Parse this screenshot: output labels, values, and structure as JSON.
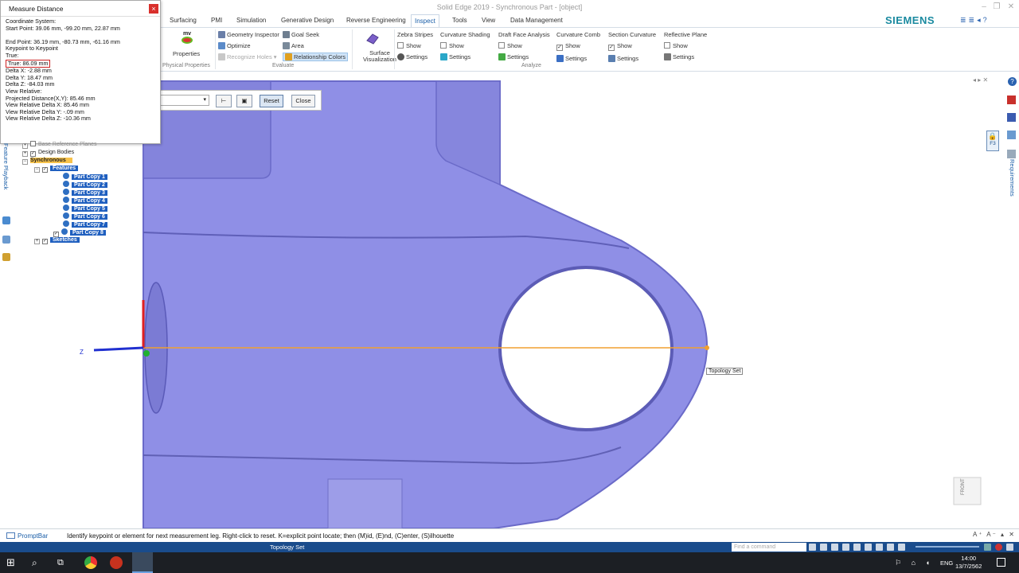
{
  "window": {
    "title": "Solid Edge 2019 - Synchronous Part - [object]",
    "brand": "SIEMENS"
  },
  "ribbon": {
    "tabs": [
      "Surfacing",
      "PMI",
      "Simulation",
      "Generative Design",
      "Reverse Engineering",
      "Inspect",
      "Tools",
      "View",
      "Data Management"
    ],
    "active_tab": "Inspect",
    "physical_properties": {
      "properties_label": "Properties",
      "mv_label": "mv",
      "group_label": "Physical Properties"
    },
    "evaluate": {
      "geometry_inspector": "Geometry Inspector",
      "goal_seek": "Goal Seek",
      "optimize": "Optimize",
      "area": "Area",
      "recognize_holes": "Recognize Holes",
      "relationship_colors": "Relationship Colors",
      "group_label": "Evaluate"
    },
    "surface_visualization": {
      "line1": "Surface",
      "line2": "Visualization"
    },
    "analyze": {
      "group_label": "Analyze",
      "sections": [
        {
          "title": "Zebra Stripes",
          "show": "Show",
          "settings": "Settings",
          "checked": false
        },
        {
          "title": "Curvature Shading",
          "show": "Show",
          "settings": "Settings",
          "checked": false
        },
        {
          "title": "Draft Face Analysis",
          "show": "Show",
          "settings": "Settings",
          "checked": false
        },
        {
          "title": "Curvature Comb",
          "show": "Show",
          "settings": "Settings",
          "checked": true
        },
        {
          "title": "Section Curvature",
          "show": "Show",
          "settings": "Settings",
          "checked": true
        },
        {
          "title": "Reflective Plane",
          "show": "Show",
          "settings": "Settings",
          "checked": false
        }
      ]
    }
  },
  "measure_dialog": {
    "title": "Measure Distance",
    "close": "×",
    "lines": {
      "coordinate_system": "Coordinate System:",
      "start_point": "Start Point:  39.06 mm, -99.20 mm, 22.87 mm",
      "end_point": "End Point:  36.19 mm, -80.73 mm, -61.16 mm",
      "keypoint": "Keypoint to Keypoint",
      "true_label": "True:",
      "true_value": "True: 86.09 mm",
      "delta_x": "Delta X:  -2.88 mm",
      "delta_y": "Delta Y:  18.47 mm",
      "delta_z": "Delta Z:  -84.03 mm",
      "view_relative": "View Relative:",
      "projected": "Projected Distance(X,Y): 85.46 mm",
      "vr_dx": "View Relative Delta X:  85.46 mm",
      "vr_dy": "View Relative Delta Y:  -.09 mm",
      "vr_dz": "View Relative Delta Z:  -10.36 mm"
    }
  },
  "command_bar": {
    "reset": "Reset",
    "close": "Close"
  },
  "pathfinder": {
    "vertical_tab": "Feature Playback",
    "rows": {
      "base_planes": "Base Reference Planes",
      "design_bodies": "Design Bodies",
      "synchronous": "Synchronous",
      "features": "Features",
      "sketches": "Sketches"
    },
    "part_copies": [
      "Part Copy 1",
      "Part Copy 2",
      "Part Copy 3",
      "Part Copy 4",
      "Part Copy 5",
      "Part Copy 6",
      "Part Copy 7",
      "Part Copy 8"
    ]
  },
  "viewport": {
    "tooltip": "Topology Set",
    "axis_z": "Z",
    "view_cube": "FRONT",
    "colors": {
      "model": "#8f8fe6",
      "measure_line": "#f0a030"
    }
  },
  "right_panel": {
    "lock_label": "F3",
    "requirements_tab": "Requirements"
  },
  "prompt_bar": {
    "label": "PromptBar",
    "text": "Identify keypoint or element for next measurement leg.  Right-click to reset.  K=explicit point locate; then (M)id, (E)nd, (C)enter, (S)ilhouette"
  },
  "status_bar": {
    "text": "Topology Set",
    "search_placeholder": "Find a command"
  },
  "taskbar": {
    "lang": "ENG",
    "time": "14:00",
    "date": "13/7/2562"
  }
}
